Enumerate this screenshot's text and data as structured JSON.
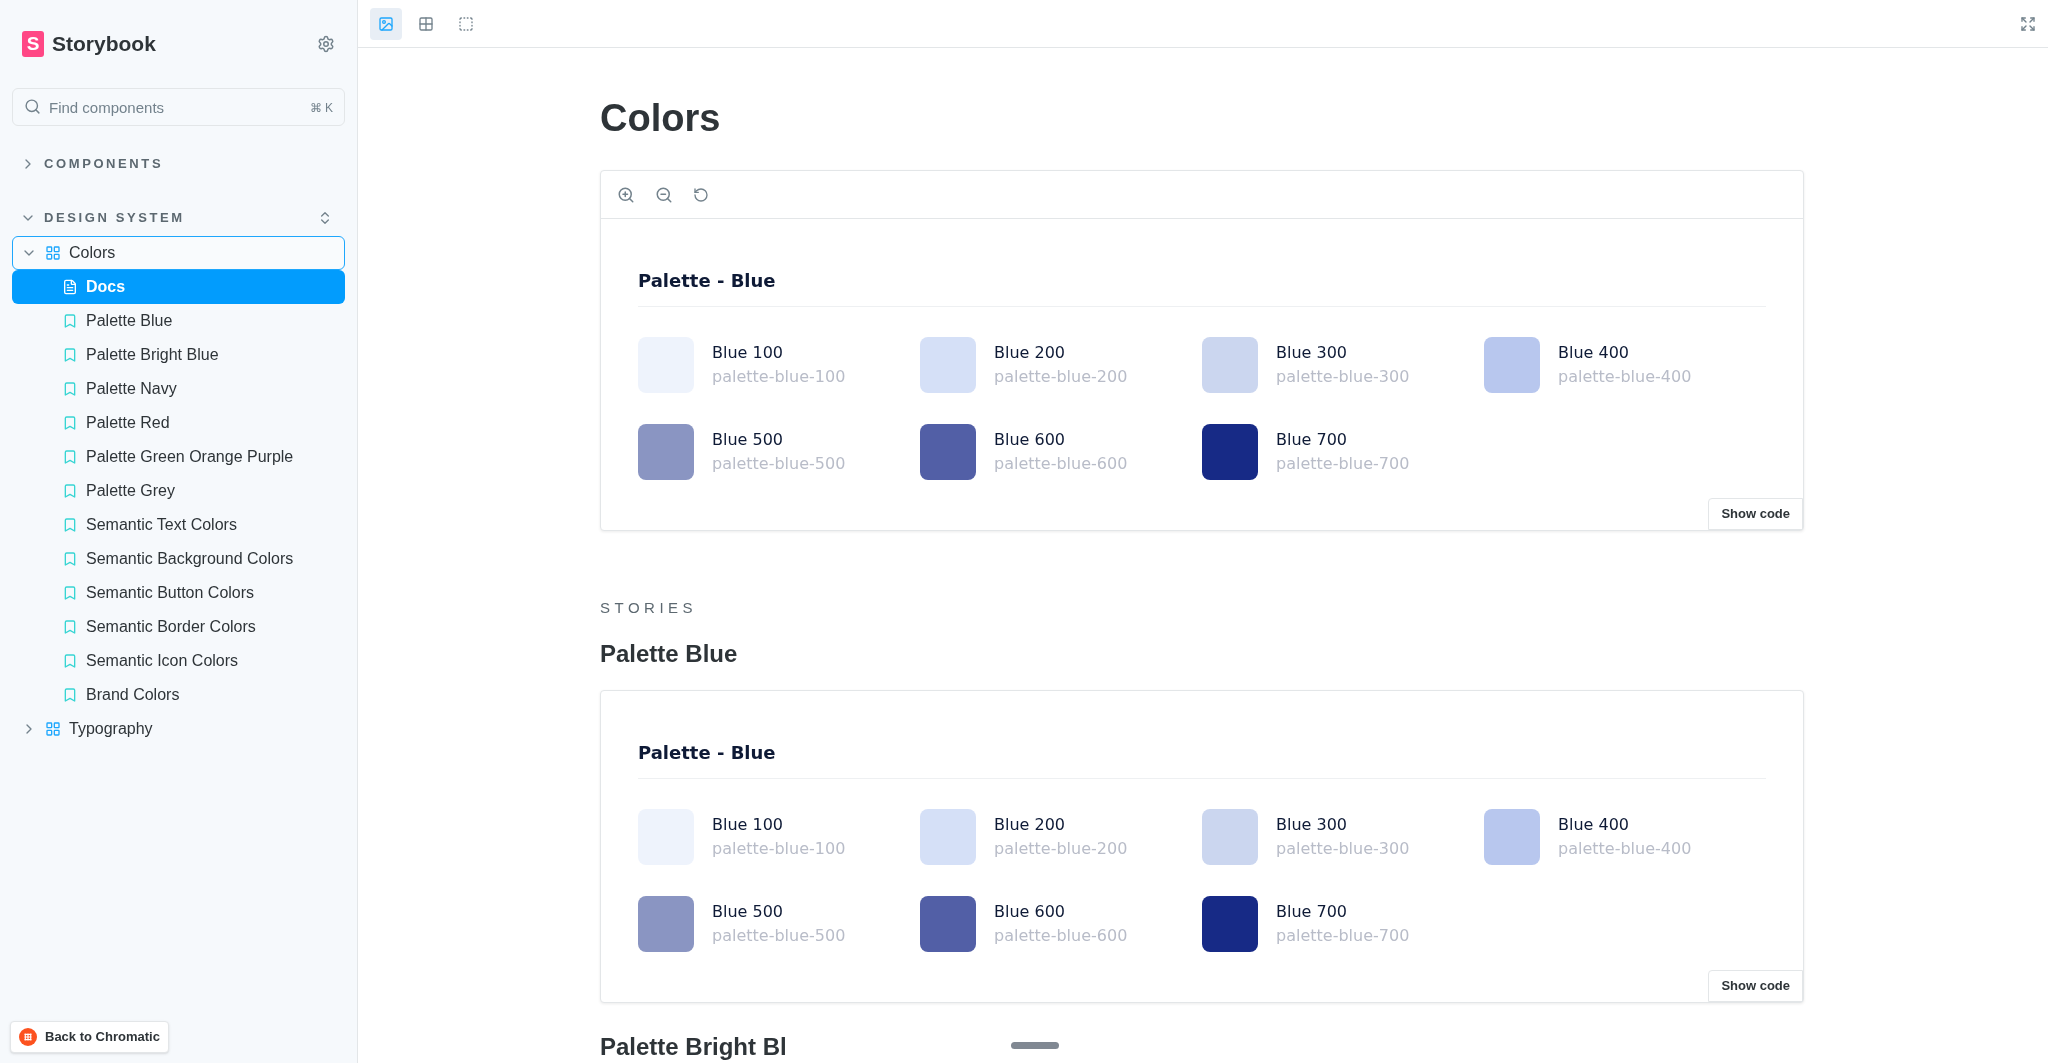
{
  "sidebar": {
    "brand": {
      "mark": "S",
      "name": "Storybook"
    },
    "search": {
      "placeholder": "Find components",
      "shortcut": "⌘ K"
    },
    "sections": [
      {
        "label": "COMPONENTS",
        "expanded": false
      },
      {
        "label": "DESIGN SYSTEM",
        "expanded": true,
        "items": [
          {
            "label": "Colors",
            "kind": "component",
            "expanded": true,
            "selected": false,
            "children": [
              {
                "label": "Docs",
                "kind": "docs",
                "selected": true
              },
              {
                "label": "Palette Blue",
                "kind": "story",
                "selected": false
              },
              {
                "label": "Palette Bright Blue",
                "kind": "story",
                "selected": false
              },
              {
                "label": "Palette Navy",
                "kind": "story",
                "selected": false
              },
              {
                "label": "Palette Red",
                "kind": "story",
                "selected": false
              },
              {
                "label": "Palette Green Orange Purple",
                "kind": "story",
                "selected": false
              },
              {
                "label": "Palette Grey",
                "kind": "story",
                "selected": false
              },
              {
                "label": "Semantic Text Colors",
                "kind": "story",
                "selected": false
              },
              {
                "label": "Semantic Background Colors",
                "kind": "story",
                "selected": false
              },
              {
                "label": "Semantic Button Colors",
                "kind": "story",
                "selected": false
              },
              {
                "label": "Semantic Border Colors",
                "kind": "story",
                "selected": false
              },
              {
                "label": "Semantic Icon Colors",
                "kind": "story",
                "selected": false
              },
              {
                "label": "Brand Colors",
                "kind": "story",
                "selected": false
              }
            ]
          },
          {
            "label": "Typography",
            "kind": "component",
            "expanded": false,
            "selected": false
          }
        ]
      }
    ],
    "back_button": "Back to Chromatic"
  },
  "toolbar": {
    "tools": [
      {
        "kind": "image",
        "selected": true
      },
      {
        "kind": "grid",
        "selected": false
      },
      {
        "kind": "outline",
        "selected": false
      }
    ]
  },
  "docs": {
    "title": "Colors",
    "preview": {
      "title": "Palette - Blue",
      "swatches": [
        {
          "name": "Blue 100",
          "token": "palette-blue-100",
          "color": "#eef3fc"
        },
        {
          "name": "Blue 200",
          "token": "palette-blue-200",
          "color": "#d5e0f7"
        },
        {
          "name": "Blue 300",
          "token": "palette-blue-300",
          "color": "#cbd6ef"
        },
        {
          "name": "Blue 400",
          "token": "palette-blue-400",
          "color": "#b8c7ee"
        },
        {
          "name": "Blue 500",
          "token": "palette-blue-500",
          "color": "#8a95c2"
        },
        {
          "name": "Blue 600",
          "token": "palette-blue-600",
          "color": "#525fa6"
        },
        {
          "name": "Blue 700",
          "token": "palette-blue-700",
          "color": "#172a86"
        }
      ],
      "show_code": "Show code"
    },
    "stories_label": "STORIES",
    "stories": [
      {
        "title": "Palette Blue",
        "preview": {
          "title": "Palette - Blue",
          "swatches": [
            {
              "name": "Blue 100",
              "token": "palette-blue-100",
              "color": "#eef3fc"
            },
            {
              "name": "Blue 200",
              "token": "palette-blue-200",
              "color": "#d5e0f7"
            },
            {
              "name": "Blue 300",
              "token": "palette-blue-300",
              "color": "#cbd6ef"
            },
            {
              "name": "Blue 400",
              "token": "palette-blue-400",
              "color": "#b8c7ee"
            },
            {
              "name": "Blue 500",
              "token": "palette-blue-500",
              "color": "#8a95c2"
            },
            {
              "name": "Blue 600",
              "token": "palette-blue-600",
              "color": "#525fa6"
            },
            {
              "name": "Blue 700",
              "token": "palette-blue-700",
              "color": "#172a86"
            }
          ],
          "show_code": "Show code"
        }
      },
      {
        "title": "Palette Bright Bl"
      }
    ]
  }
}
